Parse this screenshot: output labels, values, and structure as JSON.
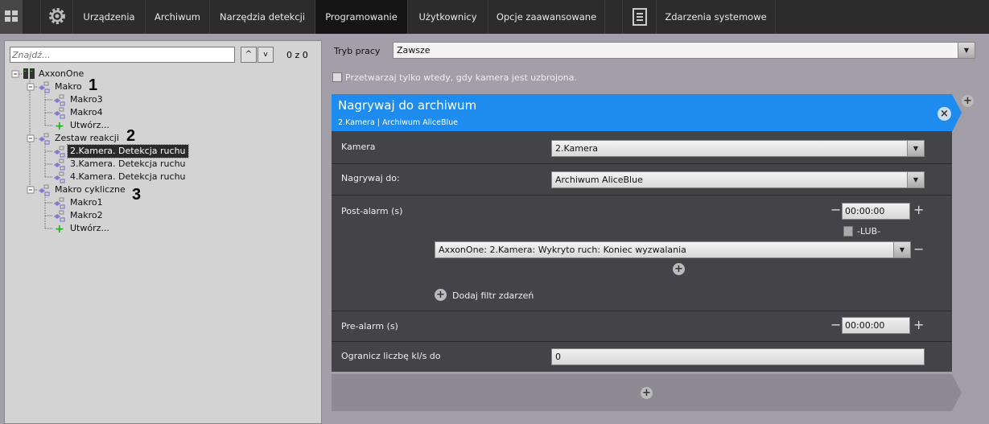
{
  "topbar": {
    "tabs": [
      {
        "label": "Urządzenia"
      },
      {
        "label": "Archiwum"
      },
      {
        "label": "Narzędzia detekcji"
      },
      {
        "label": "Programowanie"
      },
      {
        "label": "Użytkownicy"
      },
      {
        "label": "Opcje zaawansowane"
      },
      {
        "label": "Zdarzenia systemowe"
      }
    ],
    "active": "Programowanie"
  },
  "search": {
    "placeholder": "Znajdź...",
    "counter": "0 z 0"
  },
  "tree": {
    "root": "AxxonOne",
    "nodes": [
      "Makro",
      "Makro3",
      "Makro4",
      "Utwórz...",
      "Zestaw reakcji",
      "2.Kamera. Detekcja ruchu",
      "3.Kamera. Detekcja ruchu",
      "4.Kamera. Detekcja ruchu",
      "Makro cykliczne",
      "Makro1",
      "Makro2",
      "Utwórz..."
    ],
    "markers": [
      "1",
      "2",
      "3"
    ]
  },
  "main": {
    "mode_label": "Tryb pracy",
    "mode_value": "Zawsze",
    "armed_only": "Przetwarzaj tylko wtedy, gdy kamera jest uzbrojona.",
    "card": {
      "title": "Nagrywaj do archiwum",
      "subtitle": "2.Kamera | Archiwum AliceBlue",
      "camera_label": "Kamera",
      "camera_value": "2.Kamera",
      "record_label": "Nagrywaj do:",
      "record_value": "Archiwum AliceBlue",
      "post_label": "Post-alarm (s)",
      "post_value": "00:00:00",
      "or_label": "-LUB-",
      "event_value": "AxxonOne: 2.Kamera: Wykryto ruch: Koniec wyzwalania",
      "add_filter": "Dodaj filtr zdarzeń",
      "pre_label": "Pre-alarm (s)",
      "pre_value": "00:00:00",
      "fps_label": "Ogranicz liczbę kl/s do",
      "fps_value": "0"
    }
  },
  "colors": {
    "accent": "#1e8cef",
    "topbar": "#2c2c2c",
    "card_body": "#444448"
  }
}
